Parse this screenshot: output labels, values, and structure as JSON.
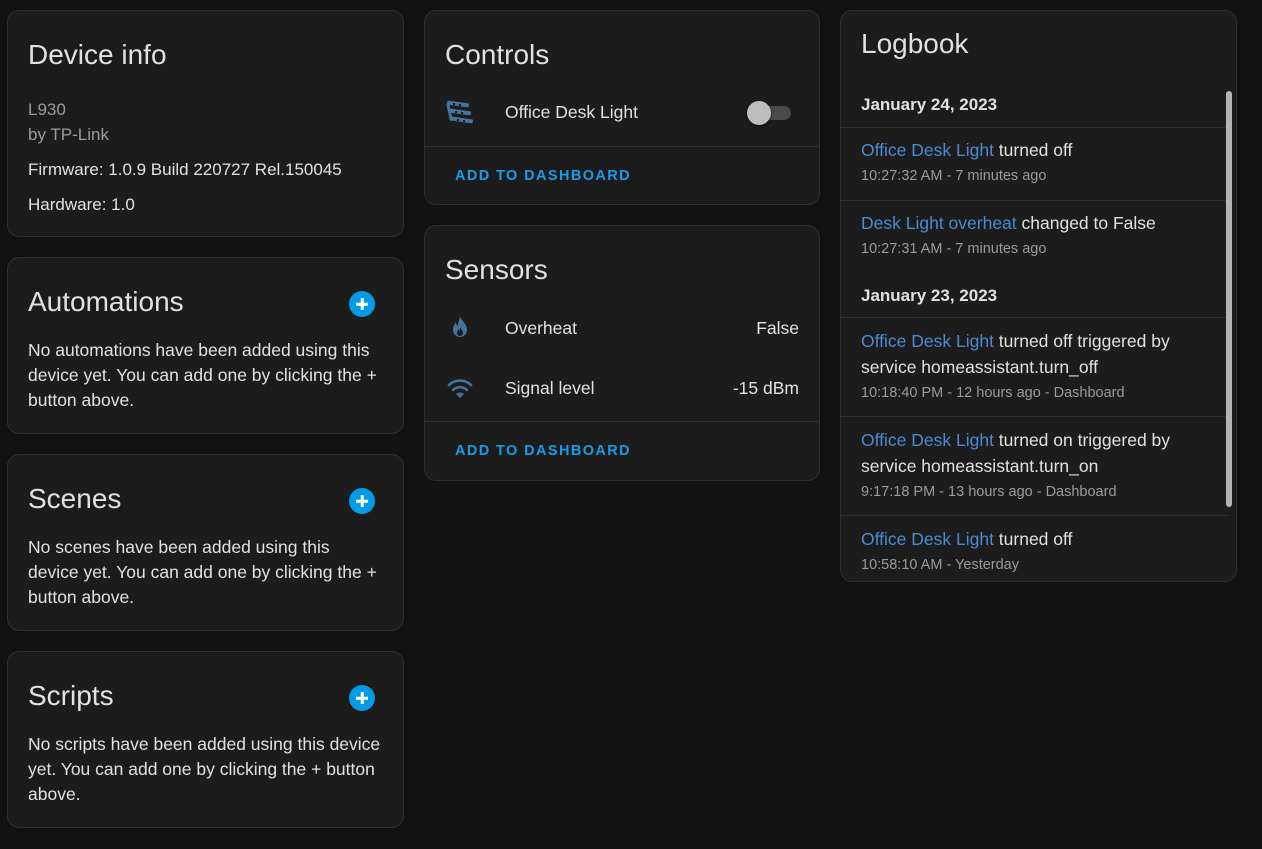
{
  "device_info": {
    "title": "Device info",
    "model": "L930",
    "manufacturer": "by TP-Link",
    "firmware": "Firmware: 1.0.9 Build 220727 Rel.150045",
    "hardware": "Hardware: 1.0"
  },
  "automations": {
    "title": "Automations",
    "message": "No automations have been added using this device yet. You can add one by clicking the + button above."
  },
  "scenes": {
    "title": "Scenes",
    "message": "No scenes have been added using this device yet. You can add one by clicking the + button above."
  },
  "scripts": {
    "title": "Scripts",
    "message": "No scripts have been added using this device yet. You can add one by clicking the + button above."
  },
  "controls": {
    "title": "Controls",
    "entity_label": "Office Desk Light",
    "entity_icon": "led-strip-icon",
    "toggle_on": false,
    "add_button": "ADD TO DASHBOARD"
  },
  "sensors": {
    "title": "Sensors",
    "rows": [
      {
        "label": "Overheat",
        "value": "False",
        "icon": "fire-icon"
      },
      {
        "label": "Signal level",
        "value": "-15 dBm",
        "icon": "wifi-icon"
      }
    ],
    "add_button": "ADD TO DASHBOARD"
  },
  "logbook": {
    "title": "Logbook",
    "dates": [
      "January 24, 2023",
      "January 23, 2023"
    ],
    "entries": [
      {
        "entity": "Office Desk Light",
        "message": " turned off",
        "time": "10:27:32 AM - 7 minutes ago"
      },
      {
        "entity": "Desk Light overheat",
        "message": " changed to False",
        "time": "10:27:31 AM - 7 minutes ago"
      },
      {
        "entity": "Office Desk Light",
        "message": " turned off triggered by service homeassistant.turn_off",
        "time": "10:18:40 PM - 12 hours ago - Dashboard"
      },
      {
        "entity": "Office Desk Light",
        "message": " turned on triggered by service homeassistant.turn_on",
        "time": "9:17:18 PM - 13 hours ago - Dashboard"
      },
      {
        "entity": "Office Desk Light",
        "message": " turned off",
        "time": "10:58:10 AM - Yesterday"
      }
    ]
  },
  "colors": {
    "accent": "#039be5",
    "entity_link": "#4c8ad1",
    "icon": "#44739e",
    "card_bg": "#1c1c1c",
    "page_bg": "#111111"
  }
}
